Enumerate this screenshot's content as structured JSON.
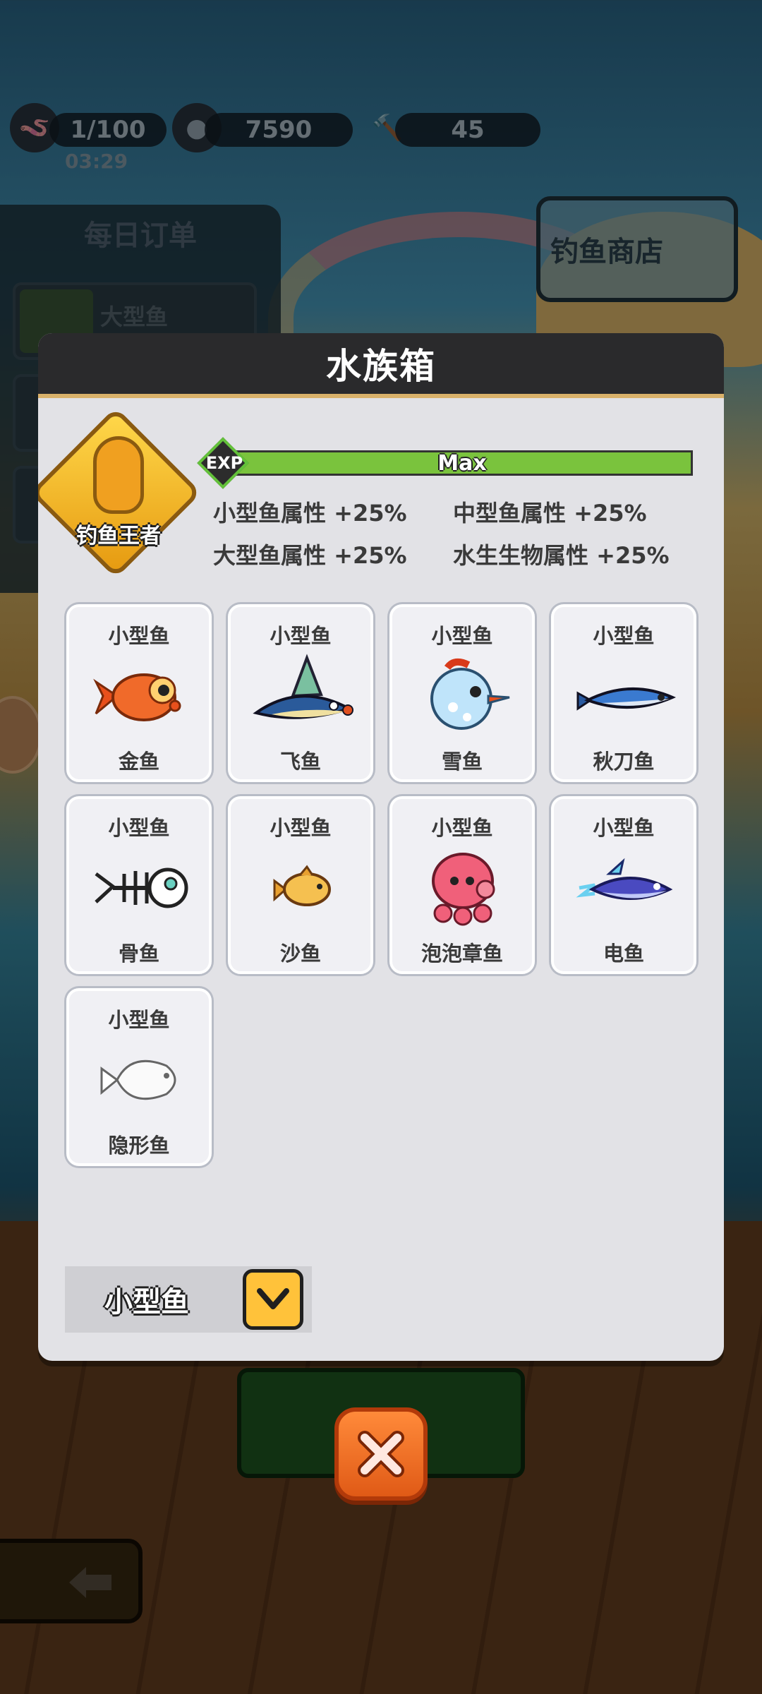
{
  "hud": {
    "bait_count": "1/100",
    "timer": "03:29",
    "coins": "7590",
    "hammer_count": "45"
  },
  "orders": {
    "title": "每日订单",
    "items": [
      {
        "label": "大型鱼"
      }
    ]
  },
  "shop": {
    "label": "钓鱼商店"
  },
  "modal": {
    "title": "水族箱",
    "badge_label": "钓鱼王者",
    "exp": {
      "label": "EXP",
      "value_text": "Max",
      "progress": 1.0
    },
    "bonuses": [
      "小型鱼属性 +25%",
      "中型鱼属性 +25%",
      "大型鱼属性 +25%",
      "水生生物属性 +25%"
    ],
    "fish": [
      {
        "category": "小型鱼",
        "name": "金鱼",
        "icon": "goldfish-icon"
      },
      {
        "category": "小型鱼",
        "name": "飞鱼",
        "icon": "flying-fish-icon"
      },
      {
        "category": "小型鱼",
        "name": "雪鱼",
        "icon": "snow-fish-icon"
      },
      {
        "category": "小型鱼",
        "name": "秋刀鱼",
        "icon": "saury-icon"
      },
      {
        "category": "小型鱼",
        "name": "骨鱼",
        "icon": "bone-fish-icon"
      },
      {
        "category": "小型鱼",
        "name": "沙鱼",
        "icon": "sand-fish-icon"
      },
      {
        "category": "小型鱼",
        "name": "泡泡章鱼",
        "icon": "bubble-octopus-icon"
      },
      {
        "category": "小型鱼",
        "name": "电鱼",
        "icon": "electric-fish-icon"
      },
      {
        "category": "小型鱼",
        "name": "隐形鱼",
        "icon": "invisible-fish-icon"
      }
    ],
    "filter": {
      "selected": "小型鱼"
    }
  },
  "colors": {
    "modal_bg": "#e2e2e6",
    "header_bg": "#2a2a2c",
    "exp_green": "#7ac33d",
    "filter_yellow": "#ffc23a",
    "close_orange": "#e05a16"
  }
}
